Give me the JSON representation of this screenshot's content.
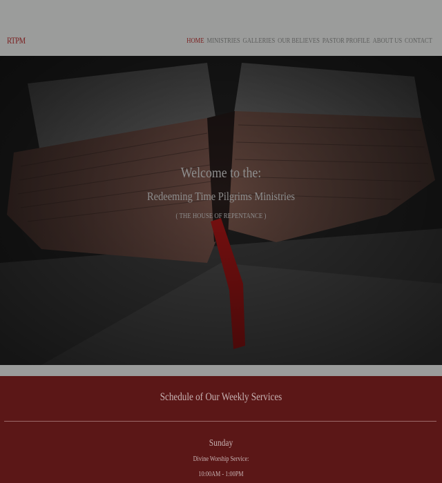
{
  "header": {
    "logo": "RTPM",
    "nav": [
      {
        "label": "HOME",
        "active": true
      },
      {
        "label": "MINISTRIES",
        "active": false
      },
      {
        "label": "GALLERIES",
        "active": false
      },
      {
        "label": "OUR BELIEVES",
        "active": false
      },
      {
        "label": "PASTOR PROFILE",
        "active": false
      },
      {
        "label": "ABOUT US",
        "active": false
      },
      {
        "label": "CONTACT",
        "active": false
      }
    ]
  },
  "hero": {
    "welcome": "Welcome to the:",
    "ministry": "Redeeming Time Pilgrims Ministries",
    "tagline": "( THE HOUSE OF REPENTANCE )"
  },
  "schedule": {
    "title": "Schedule of Our Weekly Services",
    "day": "Sunday",
    "service": "Divine Worship Service:",
    "time": "10:00AM - 1:00PM"
  },
  "colors": {
    "header_bg": "#9b9c9b",
    "accent": "#7a1e1e",
    "nav_text": "#5d5e5d",
    "hero_text": "#8e8e8e",
    "schedule_bg": "#5b1717",
    "schedule_text": "#c7b3b3"
  }
}
